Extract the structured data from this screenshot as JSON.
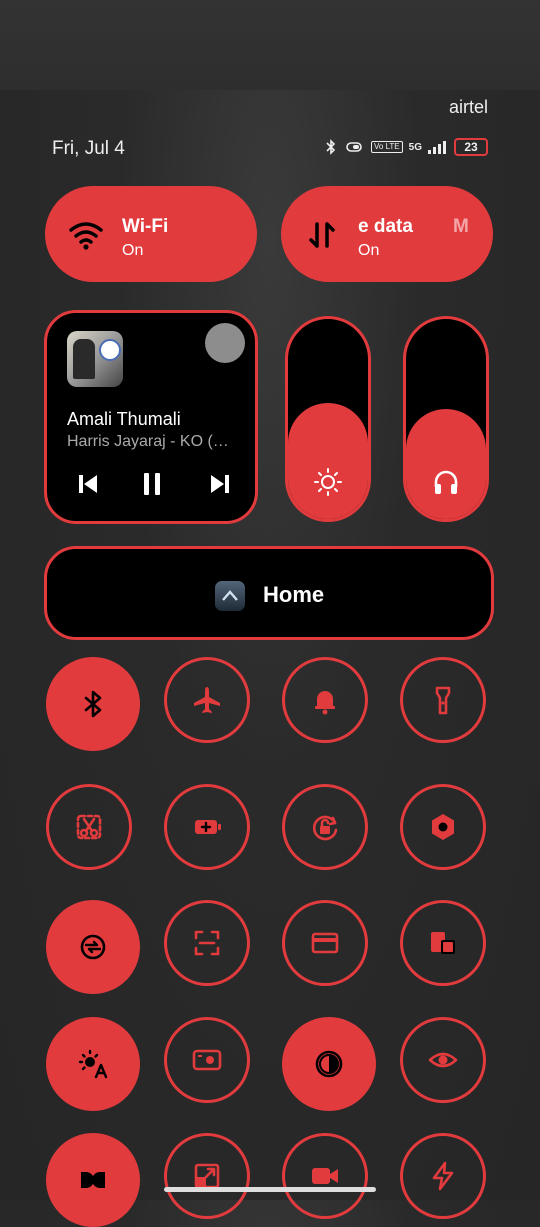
{
  "status_bar": {
    "carrier": "airtel",
    "date": "Fri, Jul 4",
    "network": "5G",
    "volte": "Vo LTE",
    "battery": "23"
  },
  "quick_toggles": {
    "wifi": {
      "title": "Wi-Fi",
      "state": "On",
      "icon": "wifi-icon"
    },
    "mobile_data": {
      "title": "e data",
      "title_trail": "M",
      "state": "On",
      "icon": "data-arrows-icon"
    }
  },
  "media": {
    "song": "Amali Thumali",
    "artist": "Harris Jayaraj - KO (…"
  },
  "sliders": {
    "brightness": {
      "level": 0.58,
      "icon": "brightness-icon"
    },
    "volume": {
      "level": 0.55,
      "icon": "headphones-icon"
    }
  },
  "home": {
    "label": "Home"
  },
  "tiles": [
    {
      "name": "bluetooth",
      "on": true,
      "icon": "bluetooth-icon"
    },
    {
      "name": "airplane-mode",
      "on": false,
      "icon": "airplane-icon"
    },
    {
      "name": "sound",
      "on": false,
      "icon": "bell-icon"
    },
    {
      "name": "flashlight",
      "on": false,
      "icon": "flashlight-icon"
    },
    {
      "name": "screenshot",
      "on": false,
      "icon": "scissors-icon"
    },
    {
      "name": "battery-saver",
      "on": false,
      "icon": "battery-plus-icon"
    },
    {
      "name": "auto-rotate",
      "on": false,
      "icon": "rotation-lock-icon"
    },
    {
      "name": "settings",
      "on": false,
      "icon": "nut-icon"
    },
    {
      "name": "sync",
      "on": true,
      "icon": "sync-icon"
    },
    {
      "name": "scanner",
      "on": false,
      "icon": "scan-icon"
    },
    {
      "name": "wallet",
      "on": false,
      "icon": "card-icon"
    },
    {
      "name": "screen-cast",
      "on": false,
      "icon": "devices-icon"
    },
    {
      "name": "auto-brightness",
      "on": true,
      "icon": "sun-a-icon"
    },
    {
      "name": "camera",
      "on": false,
      "icon": "camera-icon"
    },
    {
      "name": "dark-mode",
      "on": true,
      "icon": "contrast-icon"
    },
    {
      "name": "eye-comfort",
      "on": false,
      "icon": "eye-icon"
    },
    {
      "name": "dolby",
      "on": true,
      "icon": "dolby-icon"
    },
    {
      "name": "window",
      "on": false,
      "icon": "resize-icon"
    },
    {
      "name": "screen-record",
      "on": false,
      "icon": "video-icon"
    },
    {
      "name": "power-saver",
      "on": false,
      "icon": "bolt-icon"
    }
  ],
  "colors": {
    "accent": "#e23b3e",
    "panel": "#000000"
  }
}
